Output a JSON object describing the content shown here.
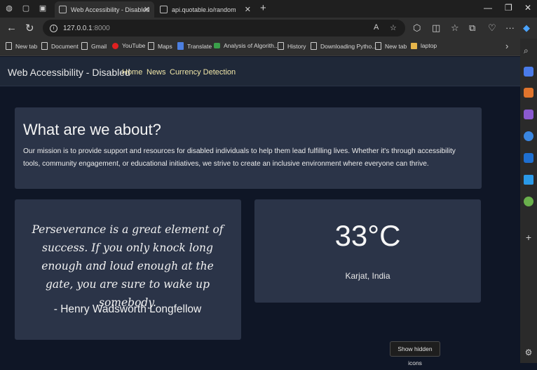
{
  "browser": {
    "tabs": [
      {
        "title": "Web Accessibility - Disabled",
        "active": true
      },
      {
        "title": "api.quotable.io/random",
        "active": false
      }
    ],
    "address": {
      "host": "127.0.0.1",
      "port": ":8000"
    },
    "bookmarks": [
      {
        "label": "New tab",
        "icon": "page-icon"
      },
      {
        "label": "Document",
        "icon": "page-icon"
      },
      {
        "label": "Gmail",
        "icon": "page-icon"
      },
      {
        "label": "YouTube",
        "icon": "youtube-icon"
      },
      {
        "label": "Maps",
        "icon": "page-icon"
      },
      {
        "label": "Translate",
        "icon": "translate-icon"
      },
      {
        "label": "Analysis of Algorith...",
        "icon": "aa-icon"
      },
      {
        "label": "History",
        "icon": "page-icon"
      },
      {
        "label": "Downloading Pytho...",
        "icon": "page-icon"
      },
      {
        "label": "New tab",
        "icon": "page-icon"
      },
      {
        "label": "laptop",
        "icon": "folder-icon"
      }
    ]
  },
  "navbar": {
    "brand": "Web Accessibility - Disabled",
    "links": [
      "Home",
      "News",
      "Currency Detection"
    ]
  },
  "about": {
    "title": "What are we about?",
    "text": "Our mission is to provide support and resources for disabled individuals to help them lead fulfilling lives. Whether it's through accessibility tools, community engagement, or educational initiatives, we strive to create an inclusive environment where everyone can thrive."
  },
  "quote": {
    "text": "Perseverance is a great element of success. If you only knock long enough and loud enough at the gate, you are sure to wake up somebody.",
    "author": "- Henry Wadsworth Longfellow"
  },
  "weather": {
    "temperature": "33°C",
    "location": "Karjat, India"
  },
  "tooltip": "Show hidden icons",
  "colors": {
    "page_bg": "#0f1626",
    "card_bg": "#2b3448",
    "nav_bg": "#1f2838",
    "nav_link": "#f0e6a8"
  }
}
